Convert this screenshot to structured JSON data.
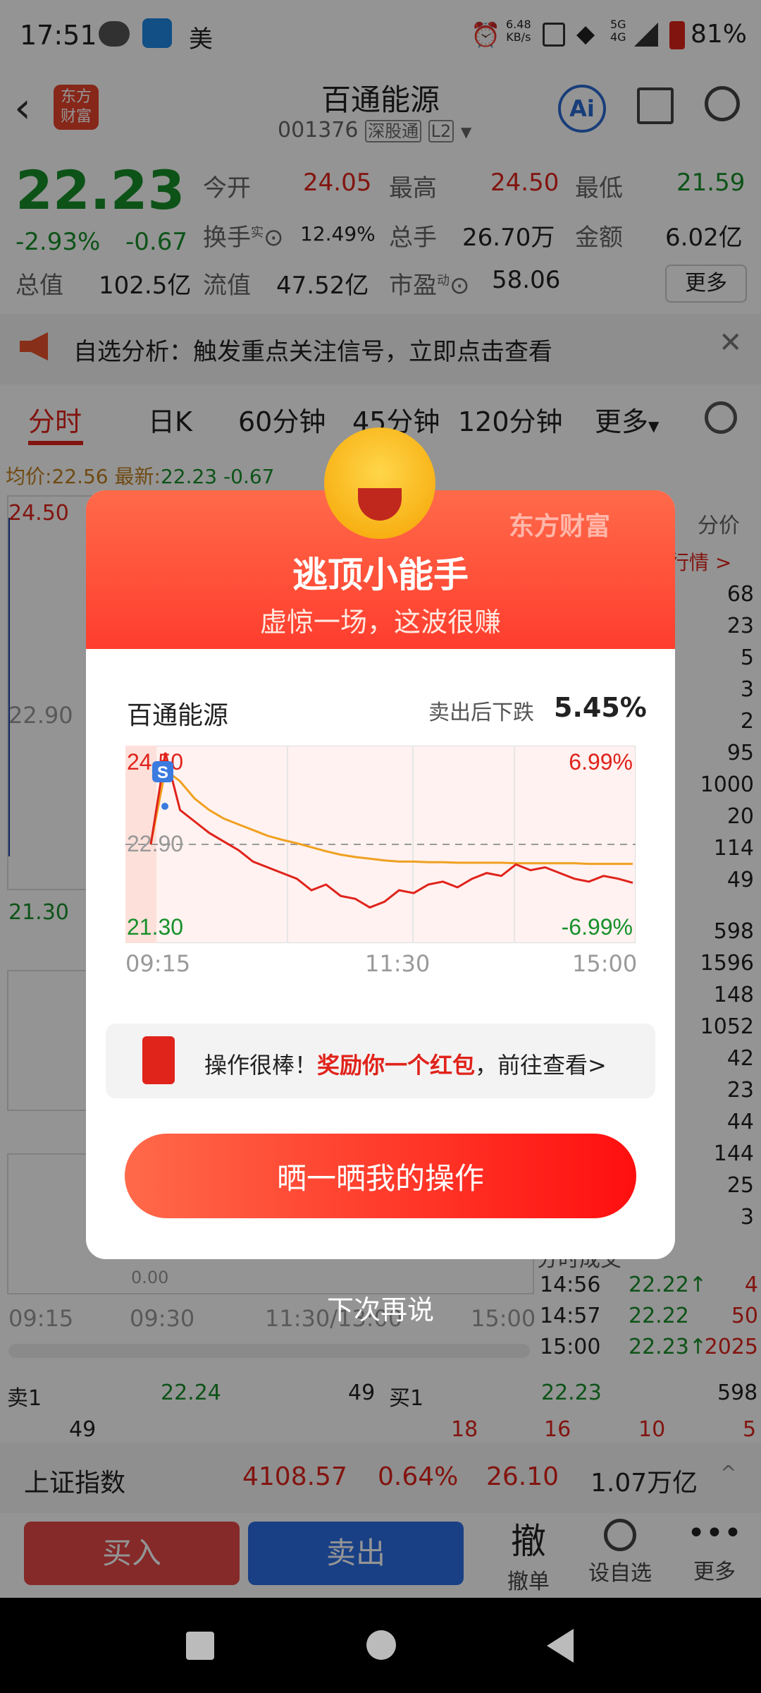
{
  "status": {
    "time": "17:51",
    "carrier_char": "美",
    "net_speed_val": "6.48",
    "net_speed_unit": "KB/s",
    "sim": "5G 4G",
    "battery": "81%"
  },
  "nav": {
    "back_icon": "chevron-left-icon",
    "logo_text": "东方\n财富",
    "title": "百通能源",
    "code": "001376",
    "tag1": "深股通",
    "tag2": "L2"
  },
  "quote": {
    "price": "22.23",
    "chg_pct": "-2.93%",
    "chg": "-0.67",
    "open_label": "今开",
    "open": "24.05",
    "high_label": "最高",
    "high": "24.50",
    "low_label": "最低",
    "low": "21.59",
    "turnover_label": "换手",
    "turnover_sup": "实",
    "turnover": "12.49%",
    "vol_label": "总手",
    "vol": "26.70万",
    "amt_label": "金额",
    "amt": "6.02亿",
    "mcap_label": "总值",
    "mcap": "102.5亿",
    "float_label": "流值",
    "float": "47.52亿",
    "pe_label": "市盈",
    "pe_sup": "动",
    "pe": "58.06",
    "more": "更多"
  },
  "notice": {
    "text": "自选分析：触发重点关注信号，立即点击查看"
  },
  "tabs": [
    "分时",
    "日K",
    "60分钟",
    "45分钟",
    "120分钟",
    "更多"
  ],
  "chart_bg": {
    "avg_label": "均价:",
    "avg": "22.56",
    "latest_label": "最新:",
    "latest": "22.23",
    "latest_chg": "-0.67",
    "hi": "24.50",
    "mid": "22.90",
    "lo": "21.30",
    "vol_zero": "0.00",
    "x_ticks": [
      "09:15",
      "09:30",
      "11:30/13:00",
      "15:00"
    ],
    "side_head": "分价",
    "side_link": "行情 >"
  },
  "side_nums": [
    "68",
    "23",
    "5",
    "3",
    "2",
    "95",
    "1000",
    "20",
    "114",
    "49",
    "598",
    "1596",
    "148",
    "1052",
    "42",
    "23",
    "44",
    "144",
    "25",
    "3"
  ],
  "trades": {
    "title": "分时成交",
    "rows": [
      {
        "t": "14:56",
        "p": "22.22↑",
        "v": "4"
      },
      {
        "t": "14:57",
        "p": "22.22",
        "v": "50"
      },
      {
        "t": "15:00",
        "p": "22.23↑",
        "v": "2025"
      }
    ]
  },
  "orderbook": {
    "sell_label": "卖1",
    "sell_price": "22.24",
    "sell_vol": "49",
    "buy_label": "买1",
    "buy_price": "22.23",
    "buy_vol": "598",
    "row2": [
      "49",
      "18",
      "16",
      "10",
      "5"
    ]
  },
  "index": {
    "name": "上证指数",
    "value": "4108.57",
    "pct": "0.64%",
    "chg": "26.10",
    "amount": "1.07万亿"
  },
  "actions": {
    "buy": "买入",
    "sell": "卖出",
    "cancel_glyph": "撤",
    "cancel": "撤单",
    "fav": "设自选",
    "more": "更多"
  },
  "modal": {
    "brand": "东方财富",
    "title": "逃顶小能手",
    "subtitle": "虚惊一场，这波很赚",
    "stock": "百通能源",
    "drop_label": "卖出后下跌",
    "drop_val": "5.45%",
    "y_hi": "24.50",
    "y_mid": "22.90",
    "y_lo": "21.30",
    "pct_hi": "6.99%",
    "pct_lo": "-6.99%",
    "x_ticks": [
      "09:15",
      "11:30",
      "15:00"
    ],
    "sell_marker": "S",
    "packet_prefix": "操作很棒！",
    "packet_em": "奖励你一个红包",
    "packet_suffix": "，前往查看>",
    "share_btn": "晒一晒我的操作",
    "dismiss": "下次再说",
    "colors": {
      "accent": "#ff3d2e",
      "price_line": "#e0231b",
      "avg_line": "#f0a020"
    }
  },
  "chart_data": {
    "type": "line",
    "x_range": [
      "09:15",
      "15:00"
    ],
    "ylim": [
      21.3,
      24.5
    ],
    "series": [
      {
        "values": [
          22.9,
          24.5,
          23.5,
          23.3,
          23.1,
          22.95,
          22.8,
          22.6,
          22.5,
          22.4,
          22.3,
          22.1,
          22.2,
          22.0,
          21.95,
          21.8,
          21.9,
          22.1,
          22.05,
          22.2,
          22.25,
          22.15,
          22.3,
          22.4,
          22.35,
          22.55,
          22.45,
          22.5,
          22.4,
          22.3,
          22.25,
          22.35,
          22.3,
          22.23
        ]
      },
      {
        "values": [
          22.9,
          24.2,
          24.0,
          23.7,
          23.5,
          23.35,
          23.25,
          23.15,
          23.05,
          22.98,
          22.92,
          22.85,
          22.78,
          22.72,
          22.68,
          22.65,
          22.62,
          22.6,
          22.6,
          22.59,
          22.59,
          22.58,
          22.58,
          22.58,
          22.58,
          22.57,
          22.57,
          22.57,
          22.57,
          22.57,
          22.56,
          22.56,
          22.56,
          22.56
        ]
      }
    ]
  }
}
